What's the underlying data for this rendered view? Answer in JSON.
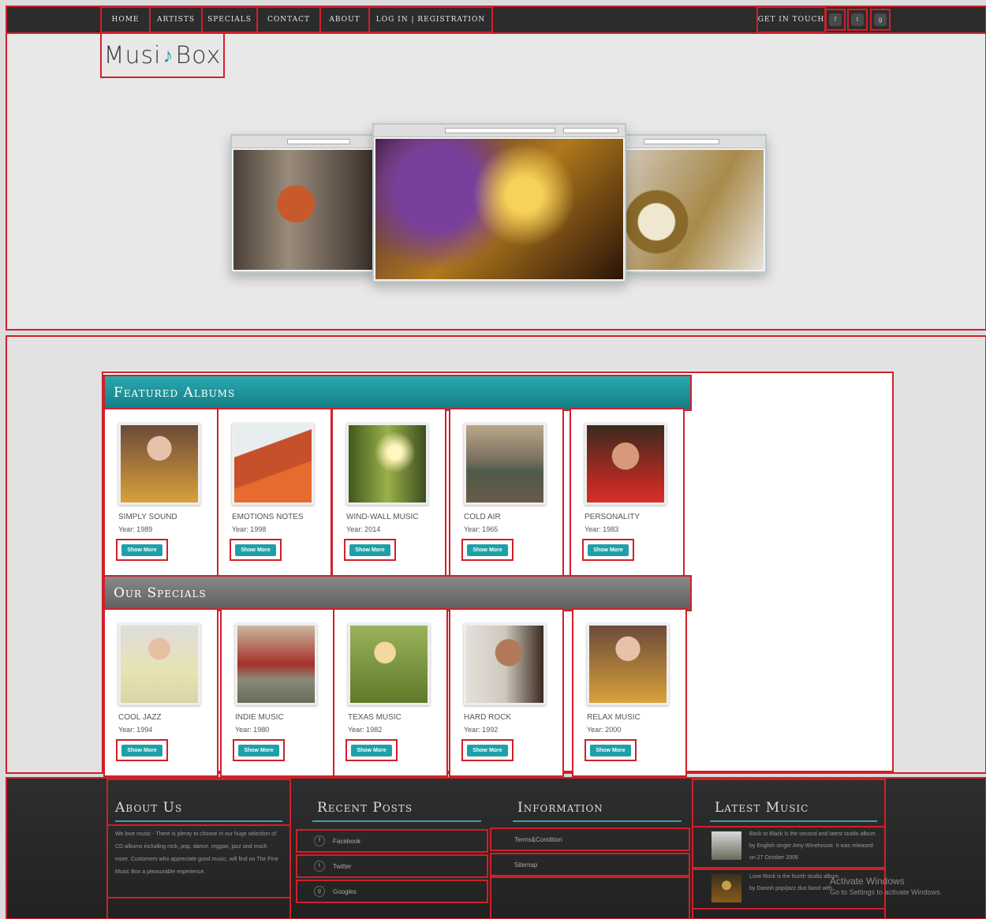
{
  "nav": {
    "items": [
      "Home",
      "Artists",
      "Specials",
      "Contact",
      "About",
      "Log In | Registration"
    ],
    "get_in_touch": "Get In Touch",
    "social": [
      "f",
      "t",
      "g"
    ]
  },
  "logo": {
    "part1": "Musi",
    "note": "♪",
    "part2": "Box"
  },
  "featured": {
    "title": "Featured Albums",
    "albums": [
      {
        "title": "Simply Sound",
        "year": "Year: 1989",
        "button": "Show More"
      },
      {
        "title": "Emotions Notes",
        "year": "Year: 1998",
        "button": "Show More"
      },
      {
        "title": "Wind-Wall Music",
        "year": "Year: 2014",
        "button": "Show More"
      },
      {
        "title": "Cold Air",
        "year": "Year: 1965",
        "button": "Show More"
      },
      {
        "title": "Personality",
        "year": "Year: 1983",
        "button": "Show More"
      }
    ]
  },
  "specials": {
    "title": "Our Specials",
    "albums": [
      {
        "title": "Cool Jazz",
        "year": "Year: 1994",
        "button": "Show More"
      },
      {
        "title": "Indie Music",
        "year": "Year: 1980",
        "button": "Show More"
      },
      {
        "title": "Texas Music",
        "year": "Year: 1982",
        "button": "Show More"
      },
      {
        "title": "Hard Rock",
        "year": "Year: 1992",
        "button": "Show More"
      },
      {
        "title": "Relax Music",
        "year": "Year: 2000",
        "button": "Show More"
      }
    ]
  },
  "footer": {
    "about": {
      "title": "About Us",
      "text": "We love music - There is plenty to choose in our huge selection of CD albums including rock, pop, dance, reggae, jazz and much more. Customers who appreciate good music, will find on The Fine Music Box a pleasurable experience."
    },
    "recent_posts": {
      "title": "Recent Posts",
      "items": [
        {
          "icon": "f",
          "label": "Facebook"
        },
        {
          "icon": "t",
          "label": "Twitter"
        },
        {
          "icon": "g",
          "label": "Googles"
        }
      ]
    },
    "information": {
      "title": "Information",
      "items": [
        "Terms&Condition",
        "Sitemap"
      ]
    },
    "latest_music": {
      "title": "Latest Music",
      "items": [
        "Back to Black is the second and latest studio album by English singer Amy Winehouse. It was released on 27 October 2006",
        "Love Rock is the fourth studio album by Danish pop/jazz duo band with"
      ]
    }
  },
  "watermark": {
    "line1": "Activate Windows",
    "line2": "Go to Settings to activate Windows."
  },
  "colors": {
    "accent": "#1fa0a8",
    "outline": "#d0202a",
    "topbar": "#2c2c2c"
  }
}
